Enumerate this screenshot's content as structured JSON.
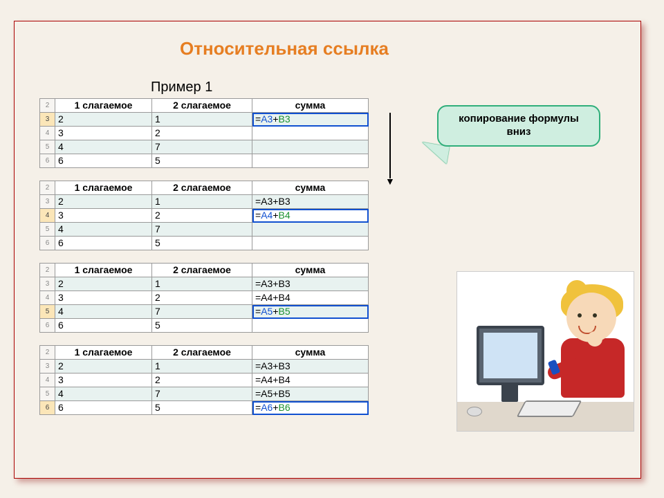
{
  "title": "Относительная ссылка",
  "subtitle": "Пример 1",
  "callout": "копирование формулы\nвниз",
  "headers": {
    "c1": "1 слагаемое",
    "c2": "2 слагаемое",
    "c3": "сумма"
  },
  "rownums": [
    "2",
    "3",
    "4",
    "5",
    "6"
  ],
  "values": {
    "a": [
      "2",
      "3",
      "4",
      "6"
    ],
    "b": [
      "1",
      "2",
      "7",
      "5"
    ]
  },
  "tables": [
    {
      "highlight_row": 0,
      "active_row": 0,
      "c_display": [
        {
          "type": "colored",
          "eq": "=",
          "ref1": "A3",
          "plus": "+",
          "ref2": "B3"
        },
        {
          "type": "plain",
          "text": ""
        },
        {
          "type": "plain",
          "text": ""
        },
        {
          "type": "plain",
          "text": ""
        }
      ]
    },
    {
      "highlight_row": 1,
      "active_row": 1,
      "c_display": [
        {
          "type": "plain",
          "text": "=A3+B3"
        },
        {
          "type": "colored",
          "eq": "=",
          "ref1": "A4",
          "plus": "+",
          "ref2": "B4"
        },
        {
          "type": "plain",
          "text": ""
        },
        {
          "type": "plain",
          "text": ""
        }
      ]
    },
    {
      "highlight_row": 2,
      "active_row": 2,
      "c_display": [
        {
          "type": "plain",
          "text": "=A3+B3"
        },
        {
          "type": "plain",
          "text": "=A4+B4"
        },
        {
          "type": "colored",
          "eq": "=",
          "ref1": "A5",
          "plus": "+",
          "ref2": "B5"
        },
        {
          "type": "plain",
          "text": ""
        }
      ]
    },
    {
      "highlight_row": 3,
      "active_row": 3,
      "c_display": [
        {
          "type": "plain",
          "text": "=A3+B3"
        },
        {
          "type": "plain",
          "text": "=A4+B4"
        },
        {
          "type": "plain",
          "text": "=A5+B5"
        },
        {
          "type": "colored",
          "eq": "=",
          "ref1": "A6",
          "plus": "+",
          "ref2": "B6"
        }
      ]
    }
  ]
}
